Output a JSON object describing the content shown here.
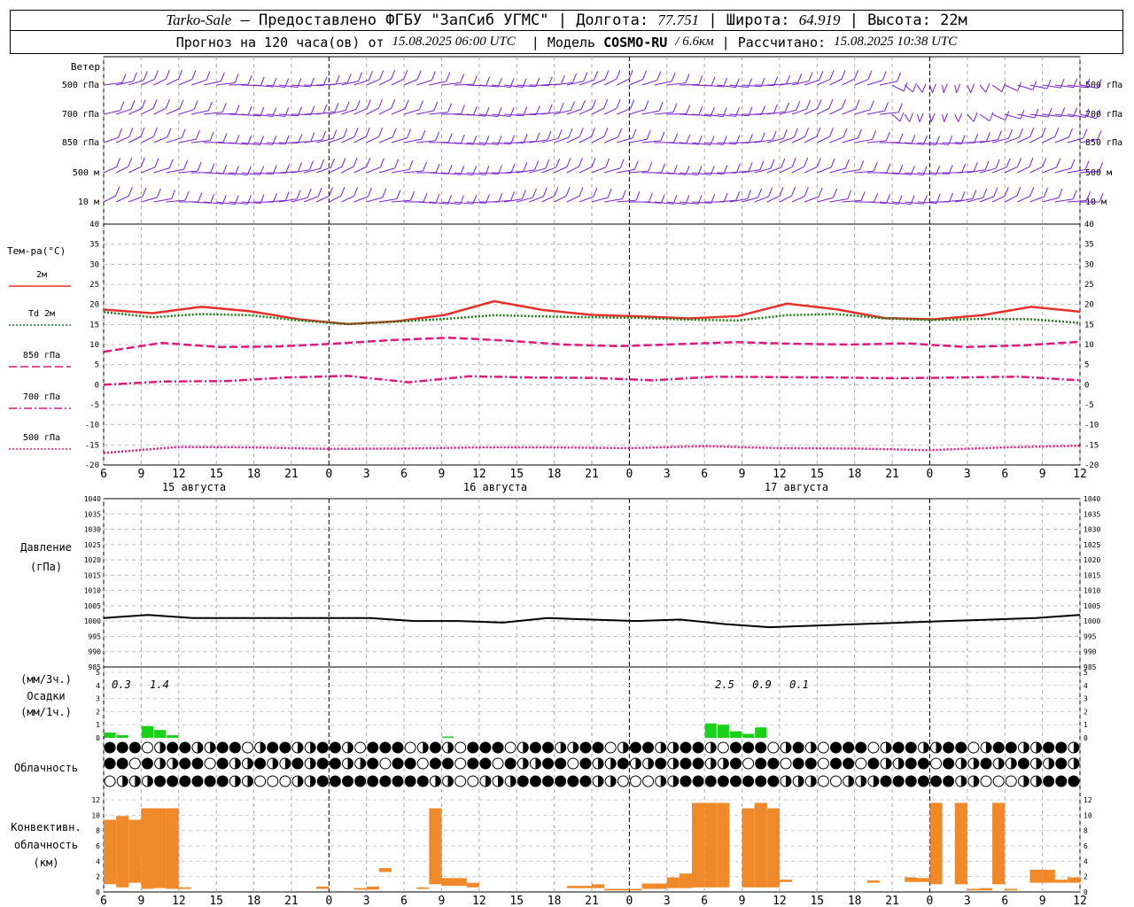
{
  "header": {
    "station": "Tarko-Sale",
    "dash": "–",
    "provider": "Предоставлено ФГБУ \"ЗапСиб УГМС\"",
    "lon_label": "Долгота:",
    "lon_value": "77.751",
    "lat_label": "Широта:",
    "lat_value": "64.919",
    "alt_label": "Высота:",
    "alt_value": "22м",
    "forecast_prefix": "Прогноз на 120 часа(ов) от",
    "forecast_time": "15.08.2025 06:00 UTC",
    "model_label": "Модель",
    "model_name": "COSMO-RU",
    "model_res": "/ 6.6км",
    "calc_label": "Рассчитано:",
    "calc_time": "15.08.2025 10:38 UTC"
  },
  "chart_data": [
    {
      "type": "wind-barbs",
      "label": "Ветер",
      "levels": [
        "500 гПа",
        "700 гПа",
        "850 гПа",
        "500 м",
        "10  м"
      ],
      "color": "#7a1fd2"
    },
    {
      "type": "line",
      "ylabel": "Тем-ра(°C)",
      "ylim": [
        -20,
        40
      ],
      "yticks": [
        -20,
        -15,
        -10,
        -5,
        0,
        5,
        10,
        15,
        20,
        25,
        30,
        35,
        40
      ],
      "x_hours": [
        0,
        6,
        12,
        18,
        24,
        30,
        36,
        42,
        48,
        54,
        60,
        66,
        72,
        78
      ],
      "series": [
        {
          "name": "2м",
          "color": "#e8302a",
          "style": "solid",
          "values": [
            18.7,
            17.8,
            19.4,
            18.3,
            16.3,
            15.1,
            15.8,
            17.4,
            20.8,
            18.6,
            17.4,
            17.0,
            16.5,
            17.1,
            20.2,
            18.8,
            16.6,
            16.3,
            17.3,
            19.4,
            18.2
          ]
        },
        {
          "name": "Td  2м",
          "color": "#1a7a1a",
          "style": "dotted",
          "values": [
            18.1,
            16.8,
            17.6,
            17.3,
            16.0,
            15.1,
            15.7,
            16.4,
            17.3,
            17.0,
            16.8,
            16.6,
            16.2,
            16.0,
            17.3,
            17.6,
            16.5,
            16.1,
            16.4,
            16.3,
            15.4
          ]
        },
        {
          "name": "850 гПа",
          "color": "#e0187a",
          "style": "dashed",
          "values": [
            8.2,
            10.4,
            9.4,
            9.5,
            10.2,
            11.1,
            11.7,
            11.0,
            10.0,
            9.6,
            10.1,
            10.6,
            10.2,
            10.0,
            10.3,
            9.4,
            9.8,
            10.7
          ]
        },
        {
          "name": "700 гПа",
          "color": "#e0187a",
          "style": "dashdot",
          "values": [
            0.0,
            0.8,
            0.9,
            1.8,
            2.2,
            0.6,
            2.1,
            1.8,
            1.7,
            1.1,
            2.0,
            1.9,
            1.8,
            1.6,
            1.8,
            2.0,
            1.1
          ]
        },
        {
          "name": "500 гПа",
          "color": "#e0187a",
          "style": "fine-dotted",
          "values": [
            -17.0,
            -15.5,
            -15.6,
            -16.0,
            -15.9,
            -15.6,
            -15.6,
            -15.8,
            -15.3,
            -15.8,
            -15.9,
            -16.3,
            -15.6,
            -15.2
          ]
        }
      ],
      "days": [
        "15 августа",
        "16 августа",
        "17 августа"
      ]
    },
    {
      "type": "line",
      "ylabel": "Давление",
      "yunit": "(гПа)",
      "ylim": [
        985,
        1040
      ],
      "yticks": [
        985,
        990,
        995,
        1000,
        1005,
        1010,
        1015,
        1020,
        1025,
        1030,
        1035,
        1040
      ],
      "series": [
        {
          "name": "Давление",
          "color": "#000000",
          "values": [
            1001,
            1002,
            1001,
            1001,
            1001,
            1001,
            1001,
            1000,
            1000,
            999.5,
            1001,
            1000.5,
            1000,
            1000.5,
            999,
            998,
            998.5,
            999,
            999.5,
            1000,
            1000.5,
            1001,
            1002
          ]
        }
      ]
    },
    {
      "type": "bar",
      "ylabel": "(мм/3ч.)",
      "ylabel2": "Осадки",
      "ylabel3": "(мм/1ч.)",
      "ylim": [
        0,
        5
      ],
      "yticks": [
        0,
        1,
        2,
        3,
        4,
        5
      ],
      "totals": [
        "0.3",
        "1.4",
        "2.5",
        "0.9",
        "0.1"
      ],
      "color": "#19d119",
      "hours": [
        0,
        1,
        3,
        4,
        5,
        27,
        48,
        49,
        50,
        51,
        52
      ],
      "values": [
        0.4,
        0.2,
        0.9,
        0.6,
        0.2,
        0.1,
        1.1,
        1.0,
        0.5,
        0.3,
        0.8
      ]
    },
    {
      "type": "symbols",
      "label": "Облачность",
      "rows": 3,
      "count": 78
    },
    {
      "type": "bar",
      "ylabel": "Конвективн.",
      "ylabel2": "облачность",
      "yunit": "(км)",
      "ylim": [
        0,
        13
      ],
      "yticks": [
        0,
        2,
        4,
        6,
        8,
        10,
        12
      ],
      "color": "#f0892a",
      "bars": [
        {
          "h": 0.5,
          "base": 1.0,
          "top": 9.4
        },
        {
          "h": 1.5,
          "base": 0.6,
          "top": 9.9
        },
        {
          "h": 2.5,
          "base": 1.2,
          "top": 9.4
        },
        {
          "h": 3.5,
          "base": 0.4,
          "top": 10.9
        },
        {
          "h": 4.5,
          "base": 0.5,
          "top": 10.9
        },
        {
          "h": 5.5,
          "base": 0.4,
          "top": 10.9
        },
        {
          "h": 6.5,
          "base": 0.4,
          "top": 0.6
        },
        {
          "h": 17.5,
          "base": 0.4,
          "top": 0.7
        },
        {
          "h": 20.5,
          "base": 0.3,
          "top": 0.5
        },
        {
          "h": 21.5,
          "base": 0.3,
          "top": 0.7
        },
        {
          "h": 22.5,
          "base": 2.6,
          "top": 3.1
        },
        {
          "h": 25.5,
          "base": 0.4,
          "top": 0.6
        },
        {
          "h": 26.5,
          "base": 1.0,
          "top": 10.9
        },
        {
          "h": 27.5,
          "base": 0.8,
          "top": 1.8
        },
        {
          "h": 28.5,
          "base": 0.8,
          "top": 1.8
        },
        {
          "h": 29.5,
          "base": 0.6,
          "top": 1.2
        },
        {
          "h": 37.5,
          "base": 0.5,
          "top": 0.8
        },
        {
          "h": 38.5,
          "base": 0.5,
          "top": 0.8
        },
        {
          "h": 39.5,
          "base": 0.5,
          "top": 1.0
        },
        {
          "h": 40.5,
          "base": 0.2,
          "top": 0.4
        },
        {
          "h": 41.5,
          "base": 0.2,
          "top": 0.4
        },
        {
          "h": 42.5,
          "base": 0.2,
          "top": 0.4
        },
        {
          "h": 43.5,
          "base": 0.4,
          "top": 1.1
        },
        {
          "h": 44.5,
          "base": 0.4,
          "top": 1.1
        },
        {
          "h": 45.5,
          "base": 0.5,
          "top": 1.9
        },
        {
          "h": 46.5,
          "base": 0.5,
          "top": 2.4
        },
        {
          "h": 47.5,
          "base": 0.6,
          "top": 11.6
        },
        {
          "h": 48.5,
          "base": 0.6,
          "top": 11.6
        },
        {
          "h": 49.5,
          "base": 0.6,
          "top": 11.6
        },
        {
          "h": 51.5,
          "base": 0.6,
          "top": 10.9
        },
        {
          "h": 52.5,
          "base": 0.6,
          "top": 11.6
        },
        {
          "h": 53.5,
          "base": 0.6,
          "top": 10.9
        },
        {
          "h": 54.5,
          "base": 1.3,
          "top": 1.6
        },
        {
          "h": 61.5,
          "base": 1.2,
          "top": 1.5
        },
        {
          "h": 64.5,
          "base": 1.3,
          "top": 1.9
        },
        {
          "h": 65.5,
          "base": 1.3,
          "top": 1.8
        },
        {
          "h": 66.5,
          "base": 1.0,
          "top": 11.6
        },
        {
          "h": 68.5,
          "base": 1.0,
          "top": 11.6
        },
        {
          "h": 69.5,
          "base": 0.2,
          "top": 0.4
        },
        {
          "h": 70.5,
          "base": 0.2,
          "top": 0.5
        },
        {
          "h": 71.5,
          "base": 1.0,
          "top": 11.6
        },
        {
          "h": 72.5,
          "base": 0.2,
          "top": 0.4
        },
        {
          "h": 74.5,
          "base": 1.2,
          "top": 2.9
        },
        {
          "h": 75.5,
          "base": 1.2,
          "top": 2.9
        },
        {
          "h": 76.5,
          "base": 1.2,
          "top": 1.6
        },
        {
          "h": 77.5,
          "base": 1.2,
          "top": 1.9
        }
      ]
    }
  ],
  "x_axis": {
    "tick_labels": [
      "6",
      "9",
      "12",
      "15",
      "18",
      "21",
      "0",
      "3",
      "6",
      "9",
      "12",
      "15",
      "18",
      "21",
      "0",
      "3",
      "6",
      "9",
      "12",
      "15",
      "18",
      "21",
      "0",
      "3",
      "6",
      "9",
      "12"
    ]
  }
}
